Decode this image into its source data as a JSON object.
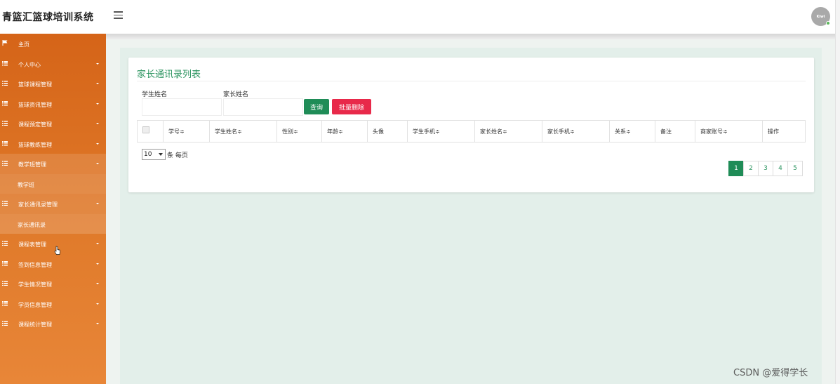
{
  "app": {
    "title": "青篮汇篮球培训系统",
    "avatar_text": "Kiwi"
  },
  "sidebar": {
    "items": [
      {
        "label": "主页",
        "icon": "flag-icon",
        "has_caret": false
      },
      {
        "label": "个人中心",
        "icon": "list-icon",
        "has_caret": true
      },
      {
        "label": "篮球课程管理",
        "icon": "list-icon",
        "has_caret": true
      },
      {
        "label": "篮球资讯管理",
        "icon": "list-icon",
        "has_caret": true
      },
      {
        "label": "课程预定管理",
        "icon": "list-icon",
        "has_caret": true
      },
      {
        "label": "篮球教练管理",
        "icon": "list-icon",
        "has_caret": true
      },
      {
        "label": "教学班管理",
        "icon": "list-icon",
        "has_caret": true,
        "expanded": true
      },
      {
        "label": "教学班",
        "sub": true
      },
      {
        "label": "家长通讯录管理",
        "icon": "list-icon",
        "has_caret": true,
        "expanded": true
      },
      {
        "label": "家长通讯录",
        "sub": true
      },
      {
        "label": "课程表管理",
        "icon": "list-icon",
        "has_caret": true
      },
      {
        "label": "签到信息管理",
        "icon": "list-icon",
        "has_caret": true
      },
      {
        "label": "学生情况管理",
        "icon": "list-icon",
        "has_caret": true
      },
      {
        "label": "学员信息管理",
        "icon": "list-icon",
        "has_caret": true
      },
      {
        "label": "课程统计管理",
        "icon": "list-icon",
        "has_caret": true
      }
    ]
  },
  "main": {
    "page_title": "家长通讯录列表",
    "search": {
      "student_name_label": "学生姓名",
      "student_name_value": "",
      "parent_name_label": "家长姓名",
      "parent_name_value": "",
      "query_button": "查询",
      "batch_delete_button": "批量删除"
    },
    "table": {
      "columns": [
        "学号",
        "学生姓名",
        "性别",
        "年龄",
        "头像",
        "学生手机",
        "家长姓名",
        "家长手机",
        "关系",
        "备注",
        "商家账号",
        "操作"
      ],
      "sortable": [
        true,
        true,
        true,
        true,
        false,
        true,
        true,
        true,
        true,
        false,
        true,
        false
      ]
    },
    "pagination": {
      "page_size": "10",
      "per_page_label": "条 每页",
      "pages": [
        "1",
        "2",
        "3",
        "4",
        "5"
      ],
      "current_page": "1"
    }
  },
  "watermark": "CSDN @爱得学长",
  "colors": {
    "sidebar_top": "#d56418",
    "sidebar_bottom": "#e88638",
    "title_green": "#2d9561",
    "button_green": "#1f8c57",
    "button_red": "#e8294a",
    "content_bg": "#e3efea"
  }
}
